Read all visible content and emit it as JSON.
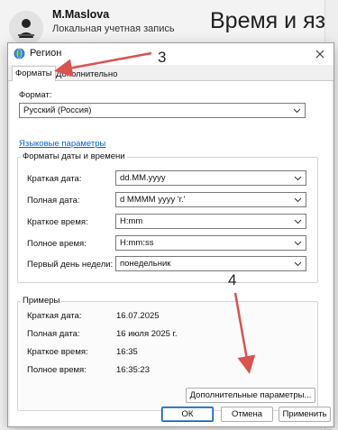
{
  "background": {
    "user_name": "M.Maslova",
    "account_type": "Локальная учетная запись",
    "page_title": "Время и язык"
  },
  "dialog": {
    "title": "Регион",
    "tabs": [
      {
        "label": "Форматы"
      },
      {
        "label": "Дополнительно"
      }
    ],
    "format_label": "Формат:",
    "format_value": "Русский (Россия)",
    "language_link": "Языковые параметры",
    "date_time_group_title": "Форматы даты и времени",
    "fields": [
      {
        "label": "Краткая дата:",
        "value": "dd.MM.yyyy"
      },
      {
        "label": "Полная дата:",
        "value": "d MMMM yyyy 'г.'"
      },
      {
        "label": "Краткое время:",
        "value": "H:mm"
      },
      {
        "label": "Полное время:",
        "value": "H:mm:ss"
      },
      {
        "label": "Первый день недели:",
        "value": "понедельник"
      }
    ],
    "examples_title": "Примеры",
    "examples": [
      {
        "label": "Краткая дата:",
        "value": "16.07.2025"
      },
      {
        "label": "Полная дата:",
        "value": "16 июля 2025 г."
      },
      {
        "label": "Краткое время:",
        "value": "16:35"
      },
      {
        "label": "Полное время:",
        "value": "16:35:23"
      }
    ],
    "additional_button": "Дополнительные параметры...",
    "ok_button": "ОК",
    "cancel_button": "Отмена",
    "apply_button": "Применить"
  },
  "annotations": {
    "step_3": "3",
    "step_4": "4"
  },
  "colors": {
    "link": "#0066cc",
    "annotation_arrow": "#d9534f",
    "primary_border": "#005fb8"
  },
  "icons": [
    "region-globe-icon",
    "close-icon",
    "chevron-down-icon",
    "avatar"
  ]
}
